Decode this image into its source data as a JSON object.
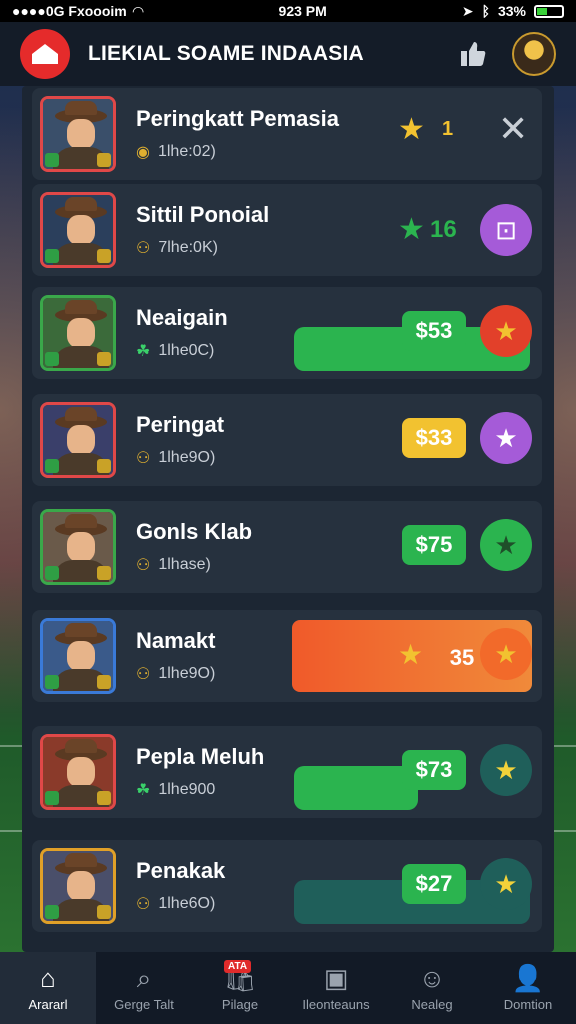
{
  "status_bar": {
    "carrier": "●●●●0G Fxoooim",
    "time": "923 PM",
    "battery": "33%"
  },
  "header": {
    "title": "LIEKIAL SOAME INDAASIA"
  },
  "rows": [
    {
      "name": "Peringkatt Pemasia",
      "sub": "1lhe:02)",
      "value": "1",
      "style": "close"
    },
    {
      "name": "Sittil Ponoial",
      "sub": "7lhe:0K)",
      "value": "16",
      "style": "star"
    },
    {
      "name": "Neaigain",
      "sub": "1lhe0C)",
      "value": "$53",
      "style": "green-red"
    },
    {
      "name": "Peringat",
      "sub": "1lhe9O)",
      "value": "$33",
      "style": "yellow-purple"
    },
    {
      "name": "Gonls Klab",
      "sub": "1lhase)",
      "value": "$75",
      "style": "green-green"
    },
    {
      "name": "Namakt",
      "sub": "1lhe9O)",
      "value": "35",
      "style": "orange"
    },
    {
      "name": "Pepla Meluh",
      "sub": "1lhe900",
      "value": "$73",
      "style": "green-teal"
    },
    {
      "name": "Penakak",
      "sub": "1lhe6O)",
      "value": "$27",
      "style": "green-teal"
    }
  ],
  "nav": [
    {
      "label": "Arararl",
      "icon": "home-icon",
      "glyph": "⌂",
      "active": true
    },
    {
      "label": "Gerge Talt",
      "icon": "search-icon",
      "glyph": "⌕"
    },
    {
      "label": "Pilage",
      "icon": "bag-icon",
      "glyph": "🛍",
      "badge": "ATA"
    },
    {
      "label": "Ileonteauns",
      "icon": "card-icon",
      "glyph": "▣"
    },
    {
      "label": "Nealeg",
      "icon": "smile-icon",
      "glyph": "☺"
    },
    {
      "label": "Domtion",
      "icon": "user-icon",
      "glyph": "👤"
    }
  ],
  "colors": {
    "green": "#2bb44f",
    "red": "#e2402a",
    "yellow": "#f2c230",
    "purple": "#a55bd8",
    "orange": "#f05a2a",
    "teal": "#1f5f5a"
  }
}
